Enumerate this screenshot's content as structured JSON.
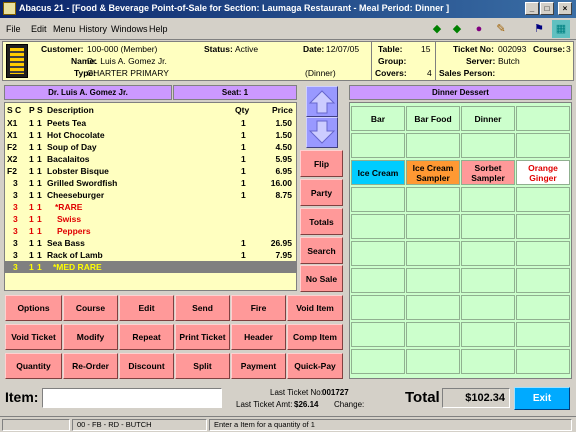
{
  "window": {
    "title": "Abacus 21 - [Food & Beverage Point-of-Sale for Section: Laumaga Restaurant - Meal Period: Dinner ]",
    "minimize": "_",
    "maximize": "□",
    "close": "×"
  },
  "menu": [
    "File",
    "Edit",
    "Menu",
    "History",
    "Windows",
    "Help"
  ],
  "toolbar_icons": [
    "back-arrow-icon",
    "forward-arrow-icon",
    "globe-icon",
    "tools-icon",
    "exit-icon",
    "calculator-icon"
  ],
  "colors": {
    "accent_red": "#ff9999",
    "accent_green": "#ccffcc",
    "accent_purple": "#cc99ff",
    "accent_blue": "#9999ff",
    "exit": "#00aaff",
    "yellow": "#ffffc0"
  },
  "info": {
    "customer_label": "Customer:",
    "customer": "100-000 (Member)",
    "name_label": "Name:",
    "name": "Dr. Luis A. Gomez Jr.",
    "type_label": "Type:",
    "type": "CHARTER PRIMARY",
    "status_label": "Status:",
    "status": "Active",
    "date_label": "Date:",
    "date": "12/07/05",
    "period": "(Dinner)",
    "table_label": "Table:",
    "table": "15",
    "group_label": "Group:",
    "group": "",
    "covers_label": "Covers:",
    "covers": "4",
    "ticket_label": "Ticket No:",
    "ticket": "002093",
    "course_label": "Course:",
    "course": "3",
    "server_label": "Server:",
    "server": "Butch",
    "sales_label": "Sales Person:",
    "sales": ""
  },
  "order": {
    "guest_header": "Dr. Luis A. Gomez Jr.",
    "seat_header": "Seat: 1",
    "columns": {
      "s": "S",
      "c": "C",
      "p": "P",
      "s2": "S",
      "desc": "Description",
      "qty": "Qty",
      "price": "Price"
    },
    "rows": [
      {
        "s": "X1",
        "c": "1",
        "p": "1",
        "desc": "Peets Tea",
        "qty": "1",
        "price": "1.50"
      },
      {
        "s": "X1",
        "c": "1",
        "p": "1",
        "desc": "Hot Chocolate",
        "qty": "1",
        "price": "1.50"
      },
      {
        "s": "F2",
        "c": "1",
        "p": "1",
        "desc": "Soup of Day",
        "qty": "1",
        "price": "4.50"
      },
      {
        "s": "X2",
        "c": "1",
        "p": "1",
        "desc": "Bacalaitos",
        "qty": "1",
        "price": "5.95"
      },
      {
        "s": "F2",
        "c": "1",
        "p": "1",
        "desc": "Lobster Bisque",
        "qty": "1",
        "price": "6.95"
      },
      {
        "s": "3",
        "c": "1",
        "p": "1",
        "desc": "Grilled Swordfish",
        "qty": "1",
        "price": "16.00"
      },
      {
        "s": "3",
        "c": "1",
        "p": "1",
        "desc": "Cheeseburger",
        "qty": "1",
        "price": "8.75"
      },
      {
        "s": "3",
        "c": "1",
        "p": "1",
        "desc": "*RARE",
        "qty": "",
        "price": ""
      },
      {
        "s": "3",
        "c": "1",
        "p": "1",
        "desc": "Swiss",
        "qty": "",
        "price": ""
      },
      {
        "s": "3",
        "c": "1",
        "p": "1",
        "desc": "Peppers",
        "qty": "",
        "price": ""
      },
      {
        "s": "3",
        "c": "1",
        "p": "1",
        "desc": "Sea Bass",
        "qty": "1",
        "price": "26.95"
      },
      {
        "s": "3",
        "c": "1",
        "p": "1",
        "desc": "Rack of Lamb",
        "qty": "1",
        "price": "7.95"
      },
      {
        "s": "3",
        "c": "1",
        "p": "1",
        "desc": "*MED RARE",
        "qty": "",
        "price": ""
      }
    ]
  },
  "side_buttons": [
    "Flip",
    "Party",
    "Totals",
    "Search",
    "No Sale"
  ],
  "action_buttons": [
    [
      "Options",
      "Course",
      "Edit",
      "Send",
      "Fire",
      "Void Item"
    ],
    [
      "Void Ticket",
      "Modify",
      "Repeat",
      "Print Ticket",
      "Header",
      "Comp Item"
    ],
    [
      "Quantity",
      "Re-Order",
      "Discount",
      "Split",
      "Payment",
      "Quick-Pay"
    ]
  ],
  "menu_panel": {
    "header": "Dinner Dessert",
    "category_buttons": [
      "Bar",
      "Bar Food",
      "Dinner",
      ""
    ],
    "item_buttons": [
      "Ice Cream",
      "Ice Cream Sampler",
      "Sorbet Sampler",
      "Orange Ginger"
    ]
  },
  "bottom": {
    "item_label": "Item:",
    "item_value": "",
    "last_ticket_label": "Last Ticket No:",
    "last_ticket": "001727",
    "last_amt_label": "Last Ticket Amt:",
    "last_amt": "$26.14",
    "change_label": "Change:",
    "change": "",
    "total_label": "Total",
    "total": "$102.34",
    "exit": "Exit"
  },
  "status": {
    "left": "",
    "mid": "00 - FB - RD - BUTCH",
    "right": "Enter a Item for a quantity of 1"
  }
}
